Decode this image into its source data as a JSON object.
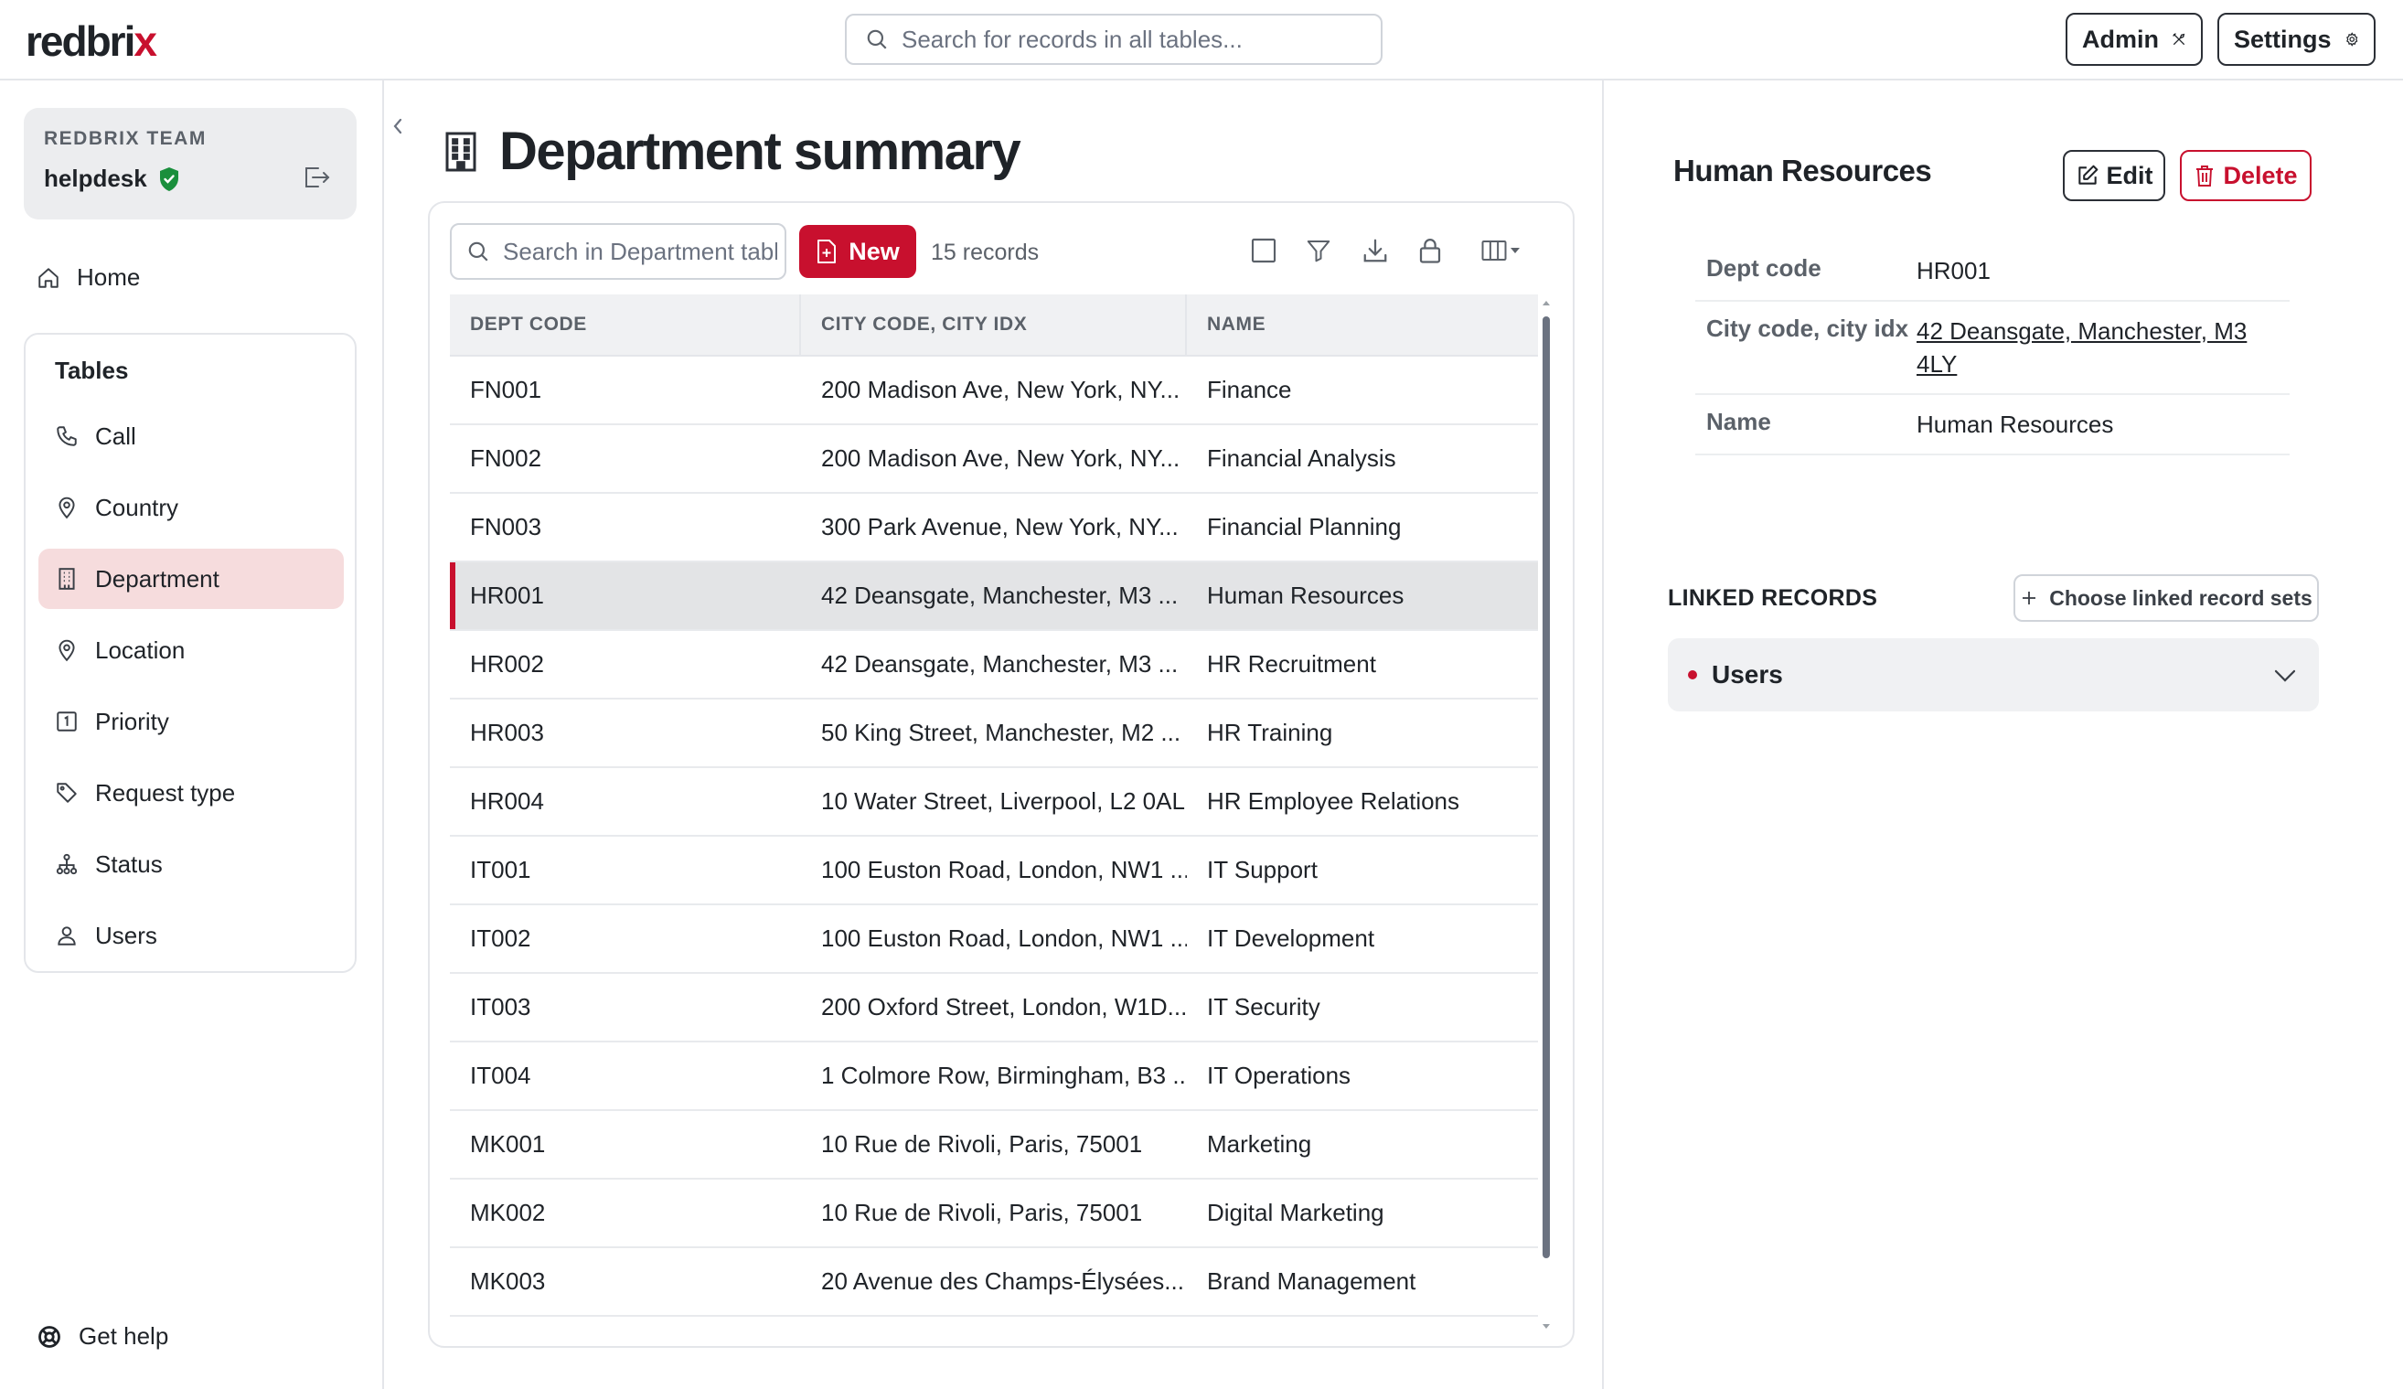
{
  "brand": {
    "logo_text_a": "redbri",
    "logo_text_x": "x",
    "accent": "#c8102e"
  },
  "header": {
    "search_placeholder": "Search for records in all tables...",
    "admin_label": "Admin",
    "settings_label": "Settings"
  },
  "sidebar": {
    "team_label": "REDBRIX TEAM",
    "team_name": "helpdesk",
    "home_label": "Home",
    "tables_title": "Tables",
    "items": [
      {
        "label": "Call",
        "icon": "phone-icon"
      },
      {
        "label": "Country",
        "icon": "map-pin-icon"
      },
      {
        "label": "Department",
        "icon": "building-icon",
        "active": true
      },
      {
        "label": "Location",
        "icon": "map-pin-icon"
      },
      {
        "label": "Priority",
        "icon": "number-one-icon"
      },
      {
        "label": "Request type",
        "icon": "tag-icon"
      },
      {
        "label": "Status",
        "icon": "hierarchy-icon"
      },
      {
        "label": "Users",
        "icon": "user-icon"
      }
    ],
    "help_label": "Get help"
  },
  "main": {
    "title": "Department summary",
    "table_search_placeholder": "Search in Department table",
    "new_label": "New",
    "record_count": "15 records",
    "columns": [
      "DEPT CODE",
      "CITY CODE, CITY IDX",
      "NAME"
    ],
    "rows": [
      [
        "FN001",
        "200 Madison Ave, New York, NY...",
        "Finance"
      ],
      [
        "FN002",
        "200 Madison Ave, New York, NY...",
        "Financial Analysis"
      ],
      [
        "FN003",
        "300 Park Avenue, New York, NY...",
        "Financial Planning"
      ],
      [
        "HR001",
        "42 Deansgate, Manchester, M3 ...",
        "Human Resources"
      ],
      [
        "HR002",
        "42 Deansgate, Manchester, M3 ...",
        "HR Recruitment"
      ],
      [
        "HR003",
        "50 King Street, Manchester, M2 ...",
        "HR Training"
      ],
      [
        "HR004",
        "10 Water Street, Liverpool, L2 0AL",
        "HR Employee Relations"
      ],
      [
        "IT001",
        "100 Euston Road, London, NW1 ...",
        "IT Support"
      ],
      [
        "IT002",
        "100 Euston Road, London, NW1 ...",
        "IT Development"
      ],
      [
        "IT003",
        "200 Oxford Street, London, W1D...",
        "IT Security"
      ],
      [
        "IT004",
        "1 Colmore Row, Birmingham, B3 ...",
        "IT Operations"
      ],
      [
        "MK001",
        "10 Rue de Rivoli, Paris, 75001",
        "Marketing"
      ],
      [
        "MK002",
        "10 Rue de Rivoli, Paris, 75001",
        "Digital Marketing"
      ],
      [
        "MK003",
        "20 Avenue des Champs-Élysées...",
        "Brand Management"
      ]
    ],
    "selected_row": 3
  },
  "detail": {
    "title": "Human Resources",
    "edit_label": "Edit",
    "delete_label": "Delete",
    "fields": [
      {
        "label": "Dept code",
        "value": "HR001"
      },
      {
        "label": "City code, city idx",
        "value": "42 Deansgate, Manchester, M3 4LY"
      },
      {
        "label": "Name",
        "value": "Human Resources"
      }
    ],
    "linked_title": "LINKED RECORDS",
    "choose_label": "Choose linked record sets",
    "linked_sets": [
      {
        "label": "Users"
      }
    ]
  }
}
